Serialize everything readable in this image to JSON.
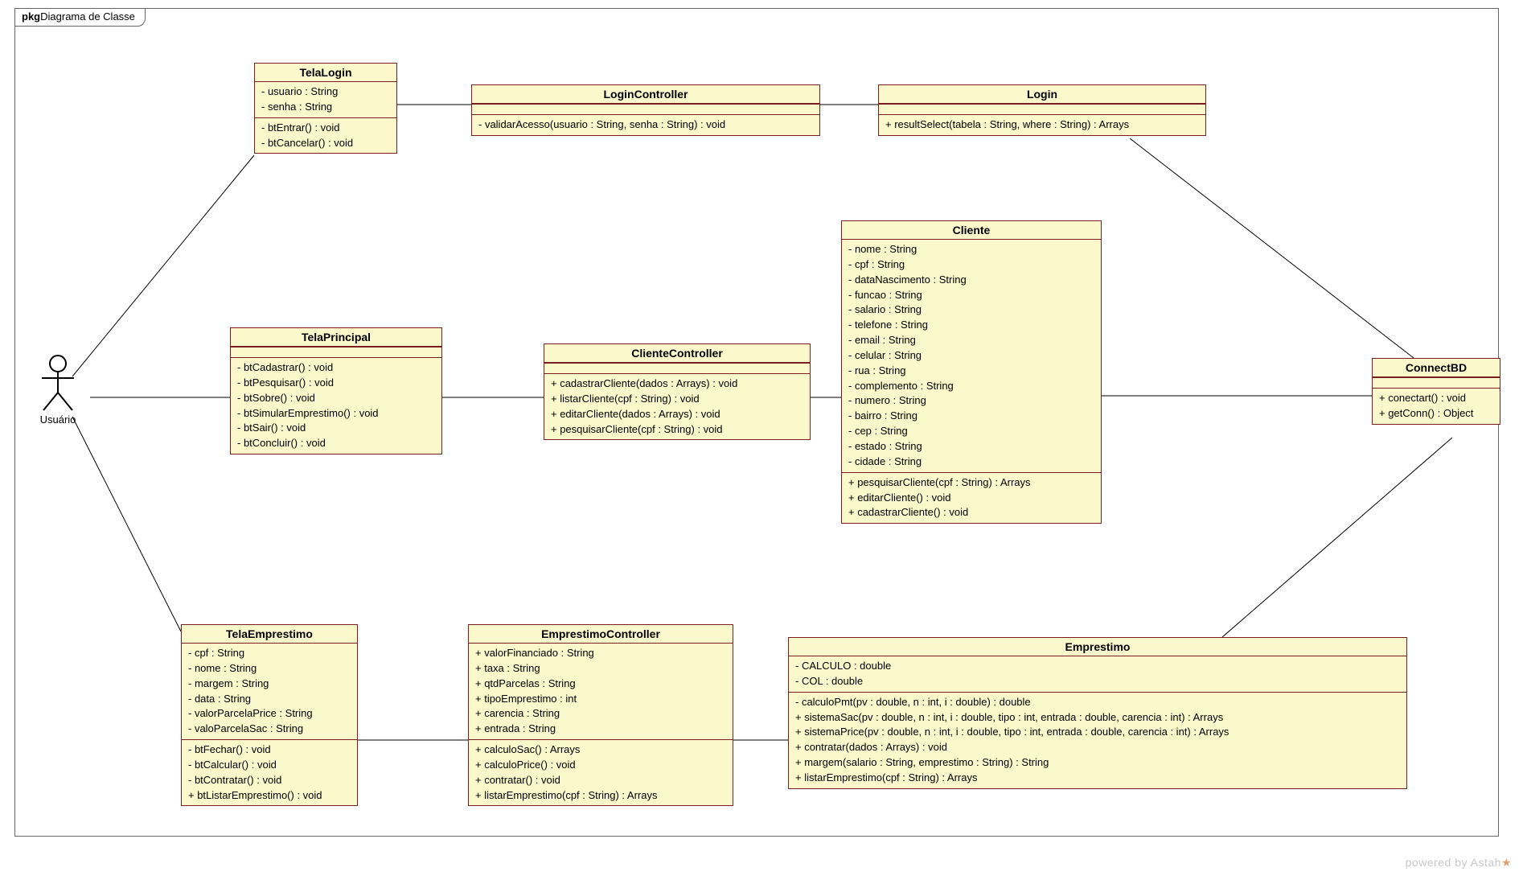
{
  "frame": {
    "prefix": "pkg",
    "title": "Diagrama de Classe"
  },
  "actor": {
    "label": "Usuário"
  },
  "watermark": {
    "text": "powered by Astah",
    "accent": "★"
  },
  "classes": {
    "telaLogin": {
      "name": "TelaLogin",
      "attrs": [
        "- usuario : String",
        "- senha : String"
      ],
      "ops": [
        "- btEntrar() : void",
        "- btCancelar() : void"
      ]
    },
    "loginController": {
      "name": "LoginController",
      "attrs": [],
      "ops": [
        "- validarAcesso(usuario : String, senha : String) : void"
      ]
    },
    "login": {
      "name": "Login",
      "attrs": [],
      "ops": [
        "+ resultSelect(tabela : String, where : String) : Arrays"
      ]
    },
    "telaPrincipal": {
      "name": "TelaPrincipal",
      "attrs": [],
      "ops": [
        "- btCadastrar() : void",
        "- btPesquisar() : void",
        "- btSobre() : void",
        "- btSimularEmprestimo() : void",
        "- btSair() : void",
        "- btConcluir() : void"
      ]
    },
    "clienteController": {
      "name": "ClienteController",
      "attrs": [],
      "ops": [
        "+ cadastrarCliente(dados : Arrays) : void",
        "+ listarCliente(cpf : String) : void",
        "+ editarCliente(dados : Arrays) : void",
        "+ pesquisarCliente(cpf : String) : void"
      ]
    },
    "cliente": {
      "name": "Cliente",
      "attrs": [
        "- nome : String",
        "- cpf : String",
        "- dataNascimento : String",
        "- funcao : String",
        "- salario : String",
        "- telefone : String",
        "- email : String",
        "- celular : String",
        "- rua : String",
        "- complemento : String",
        "- numero : String",
        "- bairro : String",
        "- cep : String",
        "- estado : String",
        "- cidade : String"
      ],
      "ops": [
        "+ pesquisarCliente(cpf : String) : Arrays",
        "+ editarCliente() : void",
        "+ cadastrarCliente() : void"
      ]
    },
    "connectBD": {
      "name": "ConnectBD",
      "attrs": [],
      "ops": [
        "+ conectart() : void",
        "+ getConn() : Object"
      ]
    },
    "telaEmprestimo": {
      "name": "TelaEmprestimo",
      "attrs": [
        "- cpf : String",
        "- nome : String",
        "- margem : String",
        "- data : String",
        "- valorParcelaPrice : String",
        "- valoParcelaSac : String"
      ],
      "ops": [
        "- btFechar() : void",
        "- btCalcular() : void",
        "- btContratar() : void",
        "+ btListarEmprestimo() : void"
      ]
    },
    "emprestimoController": {
      "name": "EmprestimoController",
      "attrs": [
        "+ valorFinanciado : String",
        "+ taxa : String",
        "+ qtdParcelas : String",
        "+ tipoEmprestimo : int",
        "+ carencia : String",
        "+ entrada : String"
      ],
      "ops": [
        "+ calculoSac() : Arrays",
        "+ calculoPrice() : void",
        "+ contratar() : void",
        "+ listarEmprestimo(cpf : String) : Arrays"
      ]
    },
    "emprestimo": {
      "name": "Emprestimo",
      "attrs": [
        "- CALCULO : double",
        "- COL : double"
      ],
      "ops": [
        "- calculoPmt(pv : double, n : int, i : double) : double",
        "+ sistemaSac(pv : double, n : int, i : double, tipo : int, entrada : double, carencia : int) : Arrays",
        "+ sistemaPrice(pv : double, n : int, i : double, tipo : int, entrada : double, carencia : int) : Arrays",
        "+ contratar(dados : Arrays) : void",
        "+ margem(salario : String, emprestimo : String) : String",
        "+ listarEmprestimo(cpf : String) : Arrays"
      ]
    }
  }
}
